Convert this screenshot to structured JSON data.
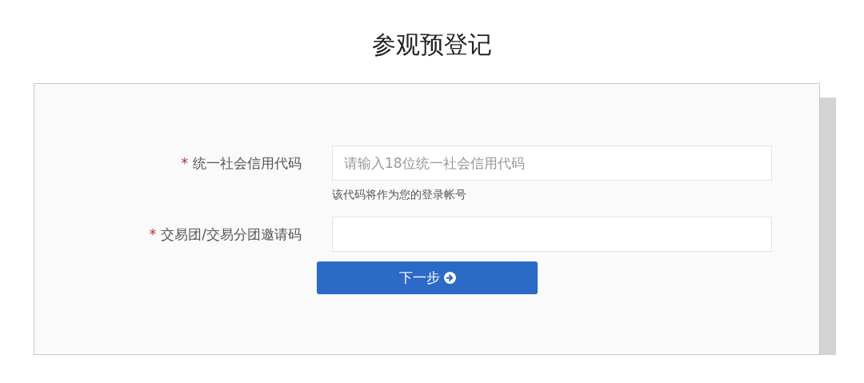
{
  "title": "参观预登记",
  "fields": [
    {
      "label": "统一社会信用代码",
      "required_mark": "*",
      "placeholder": "请输入18位统一社会信用代码",
      "hint": "该代码将作为您的登录帐号"
    },
    {
      "label": "交易团/交易分团邀请码",
      "required_mark": "*"
    }
  ],
  "button": {
    "label": "下一步"
  }
}
